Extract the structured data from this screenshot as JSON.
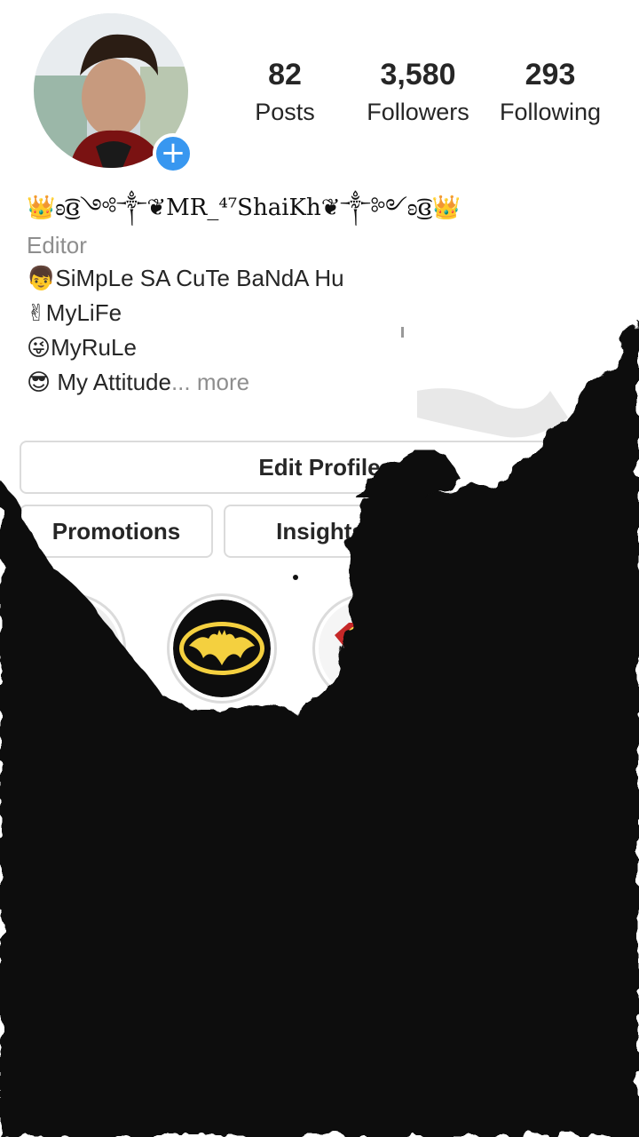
{
  "profile": {
    "name": "👑ʚ͜͡ɞ༺༒❦MR_⁴⁷ShaiKh❦༒༻ʚ͜͡ɞ👑",
    "category": "Editor",
    "bio_lines": [
      {
        "emoji": "👦",
        "text": "SiMpLe SA CuTe BaNdA Hu"
      },
      {
        "emoji": "✌",
        "text": "MyLiFe"
      },
      {
        "emoji": "😜",
        "text": "MyRuLe"
      },
      {
        "emoji": "😎",
        "text": " My Attitude"
      }
    ],
    "more_label": "... more",
    "avatar_icon": "avatar",
    "add_story_icon": "plus-icon"
  },
  "stats": {
    "posts": {
      "value": "82",
      "label": "Posts"
    },
    "followers": {
      "value": "3,580",
      "label": "Followers"
    },
    "following": {
      "value": "293",
      "label": "Following"
    }
  },
  "buttons": {
    "edit_profile": "Edit Profile",
    "promotions": "Promotions",
    "insights": "Insights"
  },
  "highlights": [
    {
      "icon": "highlight-cover"
    },
    {
      "icon": "batman-logo-icon"
    },
    {
      "icon": "superman-logo-icon"
    }
  ],
  "colors": {
    "accent": "#3897f0",
    "text": "#262626",
    "muted": "#8e8e8e",
    "border": "#dbdbdb",
    "ink": "#0a0a0a",
    "batman_yellow": "#f4d03f"
  }
}
